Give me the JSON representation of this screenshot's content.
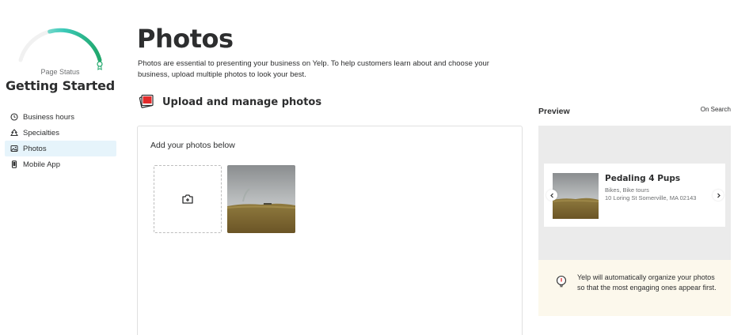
{
  "sidebar": {
    "status_label": "Page Status",
    "status_value": "Getting Started",
    "gauge_fraction": 0.6,
    "items": [
      {
        "label": "Business hours",
        "icon": "clock-icon"
      },
      {
        "label": "Specialties",
        "icon": "specialties-icon"
      },
      {
        "label": "Photos",
        "icon": "image-icon"
      },
      {
        "label": "Mobile App",
        "icon": "phone-icon"
      }
    ],
    "active_item": "Photos"
  },
  "main": {
    "title": "Photos",
    "description": "Photos are essential to presenting your business on Yelp. To help customers learn about and choose your business, upload multiple photos to look your best.",
    "section_title": "Upload and manage photos",
    "card_title": "Add your photos below"
  },
  "preview": {
    "label": "Preview",
    "mode": "On Search",
    "business": {
      "name": "Pedaling 4 Pups",
      "categories": "Bikes, Bike tours",
      "address": "10 Loring St Somerville, MA 02143"
    },
    "tip": "Yelp will automatically organize your photos so that the most engaging ones appear first."
  },
  "colors": {
    "gauge_green": "#2fbf8f",
    "gauge_teal": "#3bc9b8",
    "active_bg": "#e6f4fb",
    "tip_bg": "#fcf8ec",
    "stage_bg": "#ebebeb",
    "icon_red": "#e32b2b"
  }
}
